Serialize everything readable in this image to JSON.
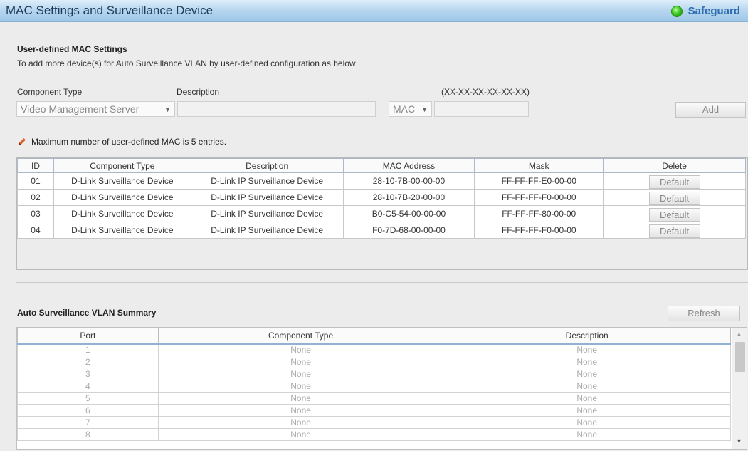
{
  "window": {
    "title": "MAC Settings and Surveillance Device",
    "safeguard_label": "Safeguard"
  },
  "user_defined": {
    "heading": "User-defined MAC Settings",
    "description": "To add more device(s) for Auto Surveillance VLAN by user-defined configuration as below",
    "component_type_label": "Component Type",
    "description_label": "Description",
    "mac_format_label": "(XX-XX-XX-XX-XX-XX)",
    "component_type_value": "Video Management Server",
    "description_value": "",
    "mac_mode_value": "MAC",
    "mac_value": "",
    "add_label": "Add",
    "note": "Maximum number of user-defined MAC is 5 entries."
  },
  "mac_table": {
    "headers": [
      "ID",
      "Component Type",
      "Description",
      "MAC Address",
      "Mask",
      "Delete"
    ],
    "rows": [
      {
        "id": "01",
        "component_type": "D-Link Surveillance Device",
        "description": "D-Link IP Surveillance Device",
        "mac": "28-10-7B-00-00-00",
        "mask": "FF-FF-FF-E0-00-00",
        "delete_label": "Default"
      },
      {
        "id": "02",
        "component_type": "D-Link Surveillance Device",
        "description": "D-Link IP Surveillance Device",
        "mac": "28-10-7B-20-00-00",
        "mask": "FF-FF-FF-F0-00-00",
        "delete_label": "Default"
      },
      {
        "id": "03",
        "component_type": "D-Link Surveillance Device",
        "description": "D-Link IP Surveillance Device",
        "mac": "B0-C5-54-00-00-00",
        "mask": "FF-FF-FF-80-00-00",
        "delete_label": "Default"
      },
      {
        "id": "04",
        "component_type": "D-Link Surveillance Device",
        "description": "D-Link IP Surveillance Device",
        "mac": "F0-7D-68-00-00-00",
        "mask": "FF-FF-FF-F0-00-00",
        "delete_label": "Default"
      }
    ]
  },
  "summary": {
    "heading": "Auto Surveillance VLAN Summary",
    "refresh_label": "Refresh",
    "headers": [
      "Port",
      "Component Type",
      "Description"
    ],
    "rows": [
      {
        "port": "1",
        "component_type": "None",
        "description": "None"
      },
      {
        "port": "2",
        "component_type": "None",
        "description": "None"
      },
      {
        "port": "3",
        "component_type": "None",
        "description": "None"
      },
      {
        "port": "4",
        "component_type": "None",
        "description": "None"
      },
      {
        "port": "5",
        "component_type": "None",
        "description": "None"
      },
      {
        "port": "6",
        "component_type": "None",
        "description": "None"
      },
      {
        "port": "7",
        "component_type": "None",
        "description": "None"
      },
      {
        "port": "8",
        "component_type": "None",
        "description": "None"
      }
    ]
  },
  "colors": {
    "title_bar": "#b9d7ef",
    "safeguard_led": "#33c11a",
    "safeguard_text": "#2d6cae"
  },
  "icons": {
    "safeguard": "status-led-icon",
    "note": "pencil-icon",
    "select_arrow": "dropdown-arrow-icon",
    "scroll_up": "scroll-up-icon",
    "scroll_down": "scroll-down-icon"
  }
}
